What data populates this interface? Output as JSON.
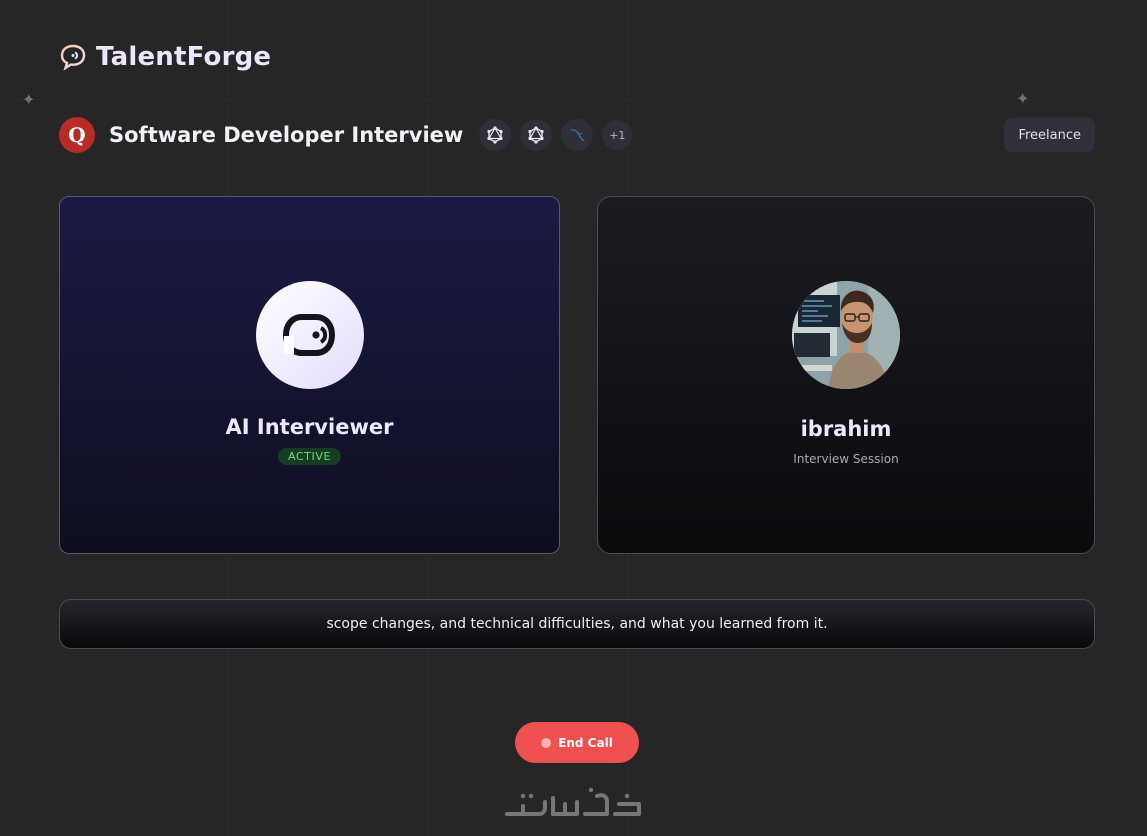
{
  "brand": {
    "name": "TalentForge",
    "icon": "chat-bubble-logo-icon"
  },
  "interview": {
    "company_initial": "Q",
    "company_color": "#b92b27",
    "title": "Software Developer Interview",
    "tech_stack_icons": [
      "graphql-icon",
      "graphql-icon",
      "mysql-dolphin-icon"
    ],
    "tech_more": "+1",
    "type": "Freelance"
  },
  "ai_card": {
    "name": "AI Interviewer",
    "status": "ACTIVE",
    "icon": "interviewer-logo-icon"
  },
  "user_card": {
    "name": "ibrahim",
    "subtitle": "Interview Session",
    "avatar": "user-avatar-photo"
  },
  "transcript": {
    "text": "scope changes, and technical difficulties, and what you learned from it."
  },
  "controls": {
    "end_call_label": "End Call"
  },
  "watermark": {
    "text": "خمسات"
  },
  "colors": {
    "background": "#262626",
    "accent": "#ece6ff",
    "danger": "#f05050",
    "active": "#5fe07d"
  }
}
